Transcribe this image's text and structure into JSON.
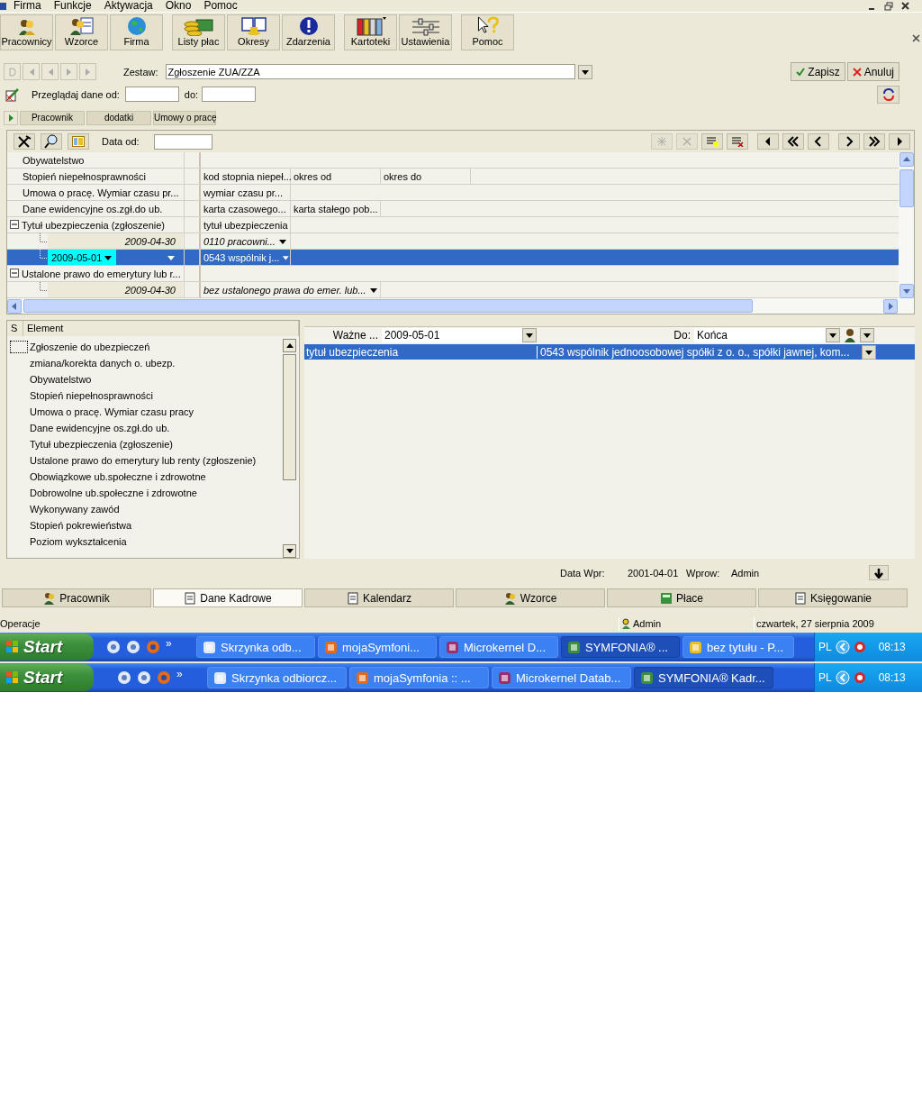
{
  "menu": [
    "Firma",
    "Funkcje",
    "Aktywacja",
    "Okno",
    "Pomoc"
  ],
  "toolbar": [
    {
      "label": "Pracownicy"
    },
    {
      "label": "Wzorce"
    },
    {
      "label": "Firma"
    },
    {
      "label": "Listy płac"
    },
    {
      "label": "Okresy"
    },
    {
      "label": "Zdarzenia"
    },
    {
      "label": "Kartoteki"
    },
    {
      "label": "Ustawienia"
    },
    {
      "label": "Pomoc"
    }
  ],
  "zestaw": {
    "label": "Zestaw:",
    "value": "Zgłoszenie ZUA/ZZA"
  },
  "actions": [
    "Zapisz",
    "Anuluj"
  ],
  "filter": {
    "label": "Przeglądaj dane od:",
    "to_label": "do:"
  },
  "subtabs": [
    "Pracownik",
    "dodatki",
    "Umowy o pracę"
  ],
  "grid": {
    "date_label": "Data od:",
    "rows": [
      {
        "name": "Obywatelstwo",
        "cells": []
      },
      {
        "name": "Stopień niepełnosprawności",
        "cells": [
          "kod stopnia niepeł...",
          "okres od",
          "okres do"
        ]
      },
      {
        "name": "Umowa o pracę. Wymiar czasu pr...",
        "cells": [
          "wymiar czasu pr..."
        ]
      },
      {
        "name": "Dane ewidencyjne os.zgł.do ub.",
        "cells": [
          "karta czasowego...",
          "karta stałego pob..."
        ]
      },
      {
        "name": "Tytuł ubezpieczenia (zgłoszenie)",
        "expanded": true,
        "cells": [
          "tytuł ubezpieczenia"
        ],
        "children": [
          {
            "date_to": "2009-04-30",
            "value": "0110 pracowni...",
            "selected": false
          },
          {
            "date_from": "2009-05-01",
            "value": "0543 wspólnik j...",
            "selected": true
          }
        ]
      },
      {
        "name": "Ustalone prawo do emerytury lub r...",
        "expanded": true,
        "cells": [],
        "children": [
          {
            "date_to": "2009-04-30",
            "value": "bez ustalonego prawa do emer. lub...",
            "selected": false
          }
        ]
      }
    ]
  },
  "elements": {
    "columns": [
      "S",
      "Element"
    ],
    "items": [
      {
        "label": "Zgłoszenie do ubezpieczeń",
        "focused": true
      },
      {
        "label": "zmiana/korekta danych o. ubezp.",
        "focused": false
      },
      {
        "label": "Obywatelstwo",
        "focused": false
      },
      {
        "label": "Stopień niepełnosprawności",
        "focused": false
      },
      {
        "label": "Umowa o pracę. Wymiar czasu pracy",
        "focused": false
      },
      {
        "label": "Dane ewidencyjne os.zgł.do ub.",
        "focused": false
      },
      {
        "label": "Tytuł ubezpieczenia (zgłoszenie)",
        "focused": false
      },
      {
        "label": "Ustalone prawo do emerytury lub renty (zgłoszenie)",
        "focused": false
      },
      {
        "label": "Obowiązkowe ub.społeczne i zdrowotne",
        "focused": false
      },
      {
        "label": "Dobrowolne ub.społeczne i zdrowotne",
        "focused": false
      },
      {
        "label": "Wykonywany zawód",
        "focused": false
      },
      {
        "label": "Stopień pokrewieństwa",
        "focused": false
      },
      {
        "label": "Poziom wykształcenia",
        "focused": false
      }
    ]
  },
  "detail": {
    "valid_label": "Ważne ...",
    "valid_from": "2009-05-01",
    "to_label": "Do:",
    "valid_to": "Końca",
    "rows": [
      {
        "name": "tytuł ubezpieczenia",
        "value": "0543 wspólnik jednoosobowej spółki z o. o., spółki jawnej, kom...",
        "selected": true
      }
    ]
  },
  "footer": {
    "entered_label": "Data Wpr:",
    "entered_date": "2001-04-01",
    "by_label": "Wprow:",
    "by": "Admin"
  },
  "bottom_tabs": [
    {
      "label": "Pracownik",
      "selected": false
    },
    {
      "label": "Dane Kadrowe",
      "selected": true
    },
    {
      "label": "Kalendarz",
      "selected": false
    },
    {
      "label": "Wzorce",
      "selected": false
    },
    {
      "label": "Płace",
      "selected": false
    },
    {
      "label": "Księgowanie",
      "selected": false
    }
  ],
  "status_bar": {
    "left": "Operacje",
    "user": "Admin",
    "date": "czwartek, 27 sierpnia 2009"
  },
  "taskbars": [
    {
      "start": "Start",
      "chevron": "»",
      "lang": "PL",
      "clock": "08:13",
      "tasks": [
        {
          "label": "Skrzynka odb...",
          "selected": false
        },
        {
          "label": "mojaSymfoni...",
          "selected": false
        },
        {
          "label": "Microkernel D...",
          "selected": false
        },
        {
          "label": "SYMFONIA® ...",
          "selected": true
        },
        {
          "label": "bez tytułu - P...",
          "selected": false
        }
      ]
    },
    {
      "start": "Start",
      "chevron": "»",
      "lang": "PL",
      "clock": "08:13",
      "tasks": [
        {
          "label": "Skrzynka odbiorcz...",
          "selected": false
        },
        {
          "label": "mojaSymfonia :: ...",
          "selected": false
        },
        {
          "label": "Microkernel Datab...",
          "selected": false
        },
        {
          "label": "SYMFONIA® Kadr...",
          "selected": true
        }
      ]
    }
  ]
}
